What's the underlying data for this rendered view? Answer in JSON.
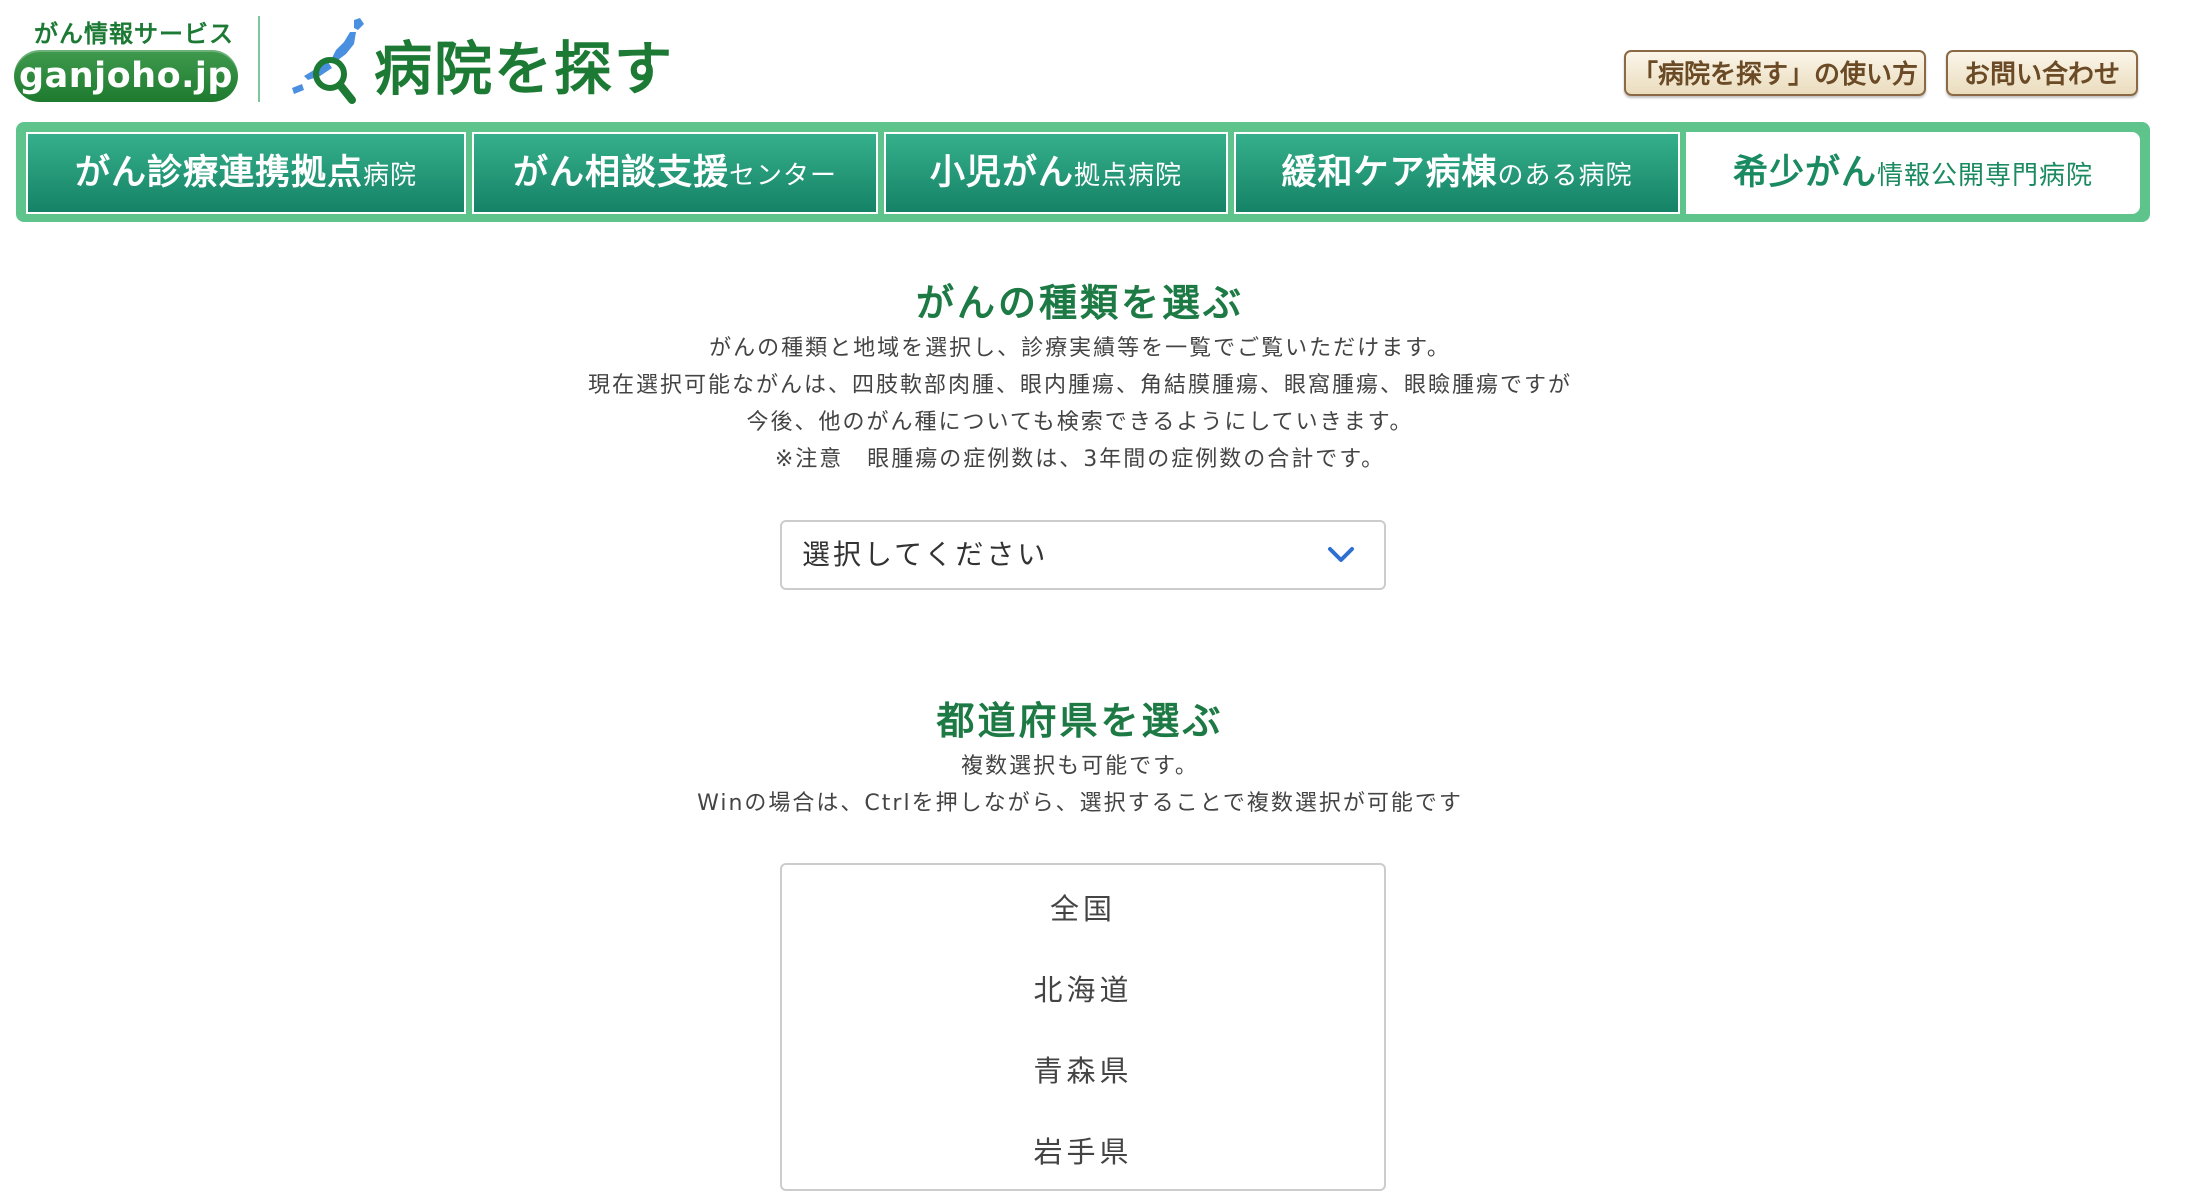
{
  "header": {
    "logo_tagline": "がん情報サービス",
    "logo_name": "ganjoho.jp",
    "page_title": "病院を探す",
    "howto_button": "「病院を探す」の使い方",
    "contact_button": "お問い合わせ"
  },
  "nav": {
    "tabs": [
      {
        "big": "がん診療連携拠点",
        "small": "病院"
      },
      {
        "big": "がん相談支援",
        "small": "センター"
      },
      {
        "big": "小児がん",
        "small": "拠点病院"
      },
      {
        "big": "緩和ケア病棟",
        "small": "のある病院"
      },
      {
        "big": "希少がん",
        "small": "情報公開専門病院"
      }
    ],
    "active_index": 4
  },
  "cancer_type": {
    "title": "がんの種類を選ぶ",
    "lines": [
      "がんの種類と地域を選択し、診療実績等を一覧でご覧いただけます。",
      "現在選択可能ながんは、四肢軟部肉腫、眼内腫瘍、角結膜腫瘍、眼窩腫瘍、眼瞼腫瘍ですが",
      "今後、他のがん種についても検索できるようにしていきます。",
      "※注意　眼腫瘍の症例数は、3年間の症例数の合計です。"
    ],
    "select_value": "選択してください"
  },
  "prefecture": {
    "title": "都道府県を選ぶ",
    "lines": [
      "複数選択も可能です。",
      "Winの場合は、Ctrlを押しながら、選択することで複数選択が可能です"
    ],
    "options": [
      "全国",
      "北海道",
      "青森県",
      "岩手県"
    ]
  },
  "colors": {
    "brand_green": "#1d7a35",
    "nav_green": "#1f9474",
    "nav_frame": "#5fc38c",
    "button_brown": "#6b4a26",
    "chevron_blue": "#2e6fd0"
  }
}
